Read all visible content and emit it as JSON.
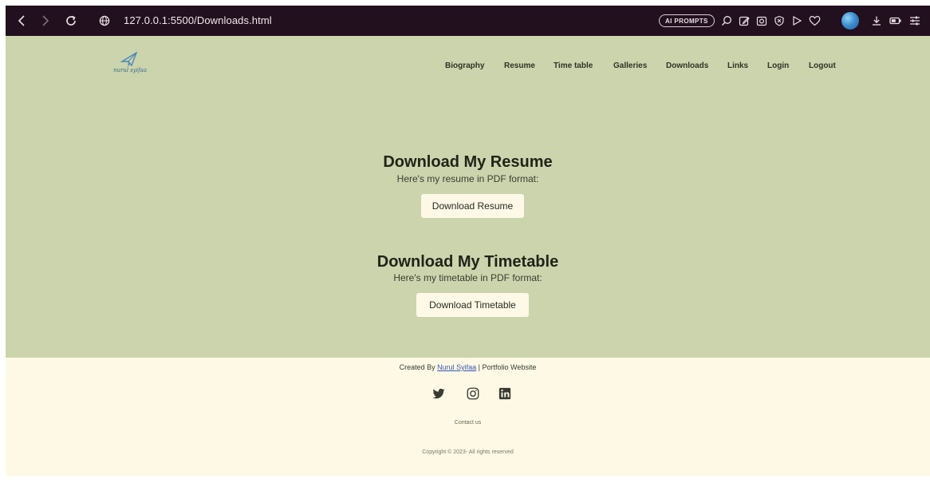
{
  "browser": {
    "url": "127.0.0.1:5500/Downloads.html",
    "ai_pill_label": "AI PROMPTS",
    "toolbar_color": "#22101f"
  },
  "header": {
    "logo_text": "nurul syifaa",
    "nav": [
      "Biography",
      "Resume",
      "Time table",
      "Galleries",
      "Downloads",
      "Links",
      "Login",
      "Logout"
    ]
  },
  "main": {
    "background": "#cbd4ad",
    "sections": [
      {
        "title": "Download My Resume",
        "subtitle": "Here's my resume in PDF format:",
        "button_label": "Download Resume"
      },
      {
        "title": "Download My Timetable",
        "subtitle": "Here's my timetable in PDF format:",
        "button_label": "Download Timetable"
      }
    ]
  },
  "footer": {
    "background": "#fdf9e4",
    "credit_prefix": "Created By ",
    "credit_link": "Nurul Syifaa",
    "credit_suffix": " | Portfolio Website",
    "social_icons": [
      "twitter-icon",
      "instagram-icon",
      "linkedin-icon"
    ],
    "contact": "Contact us",
    "copyright": "Copyright © 2023- All rights reserved"
  }
}
